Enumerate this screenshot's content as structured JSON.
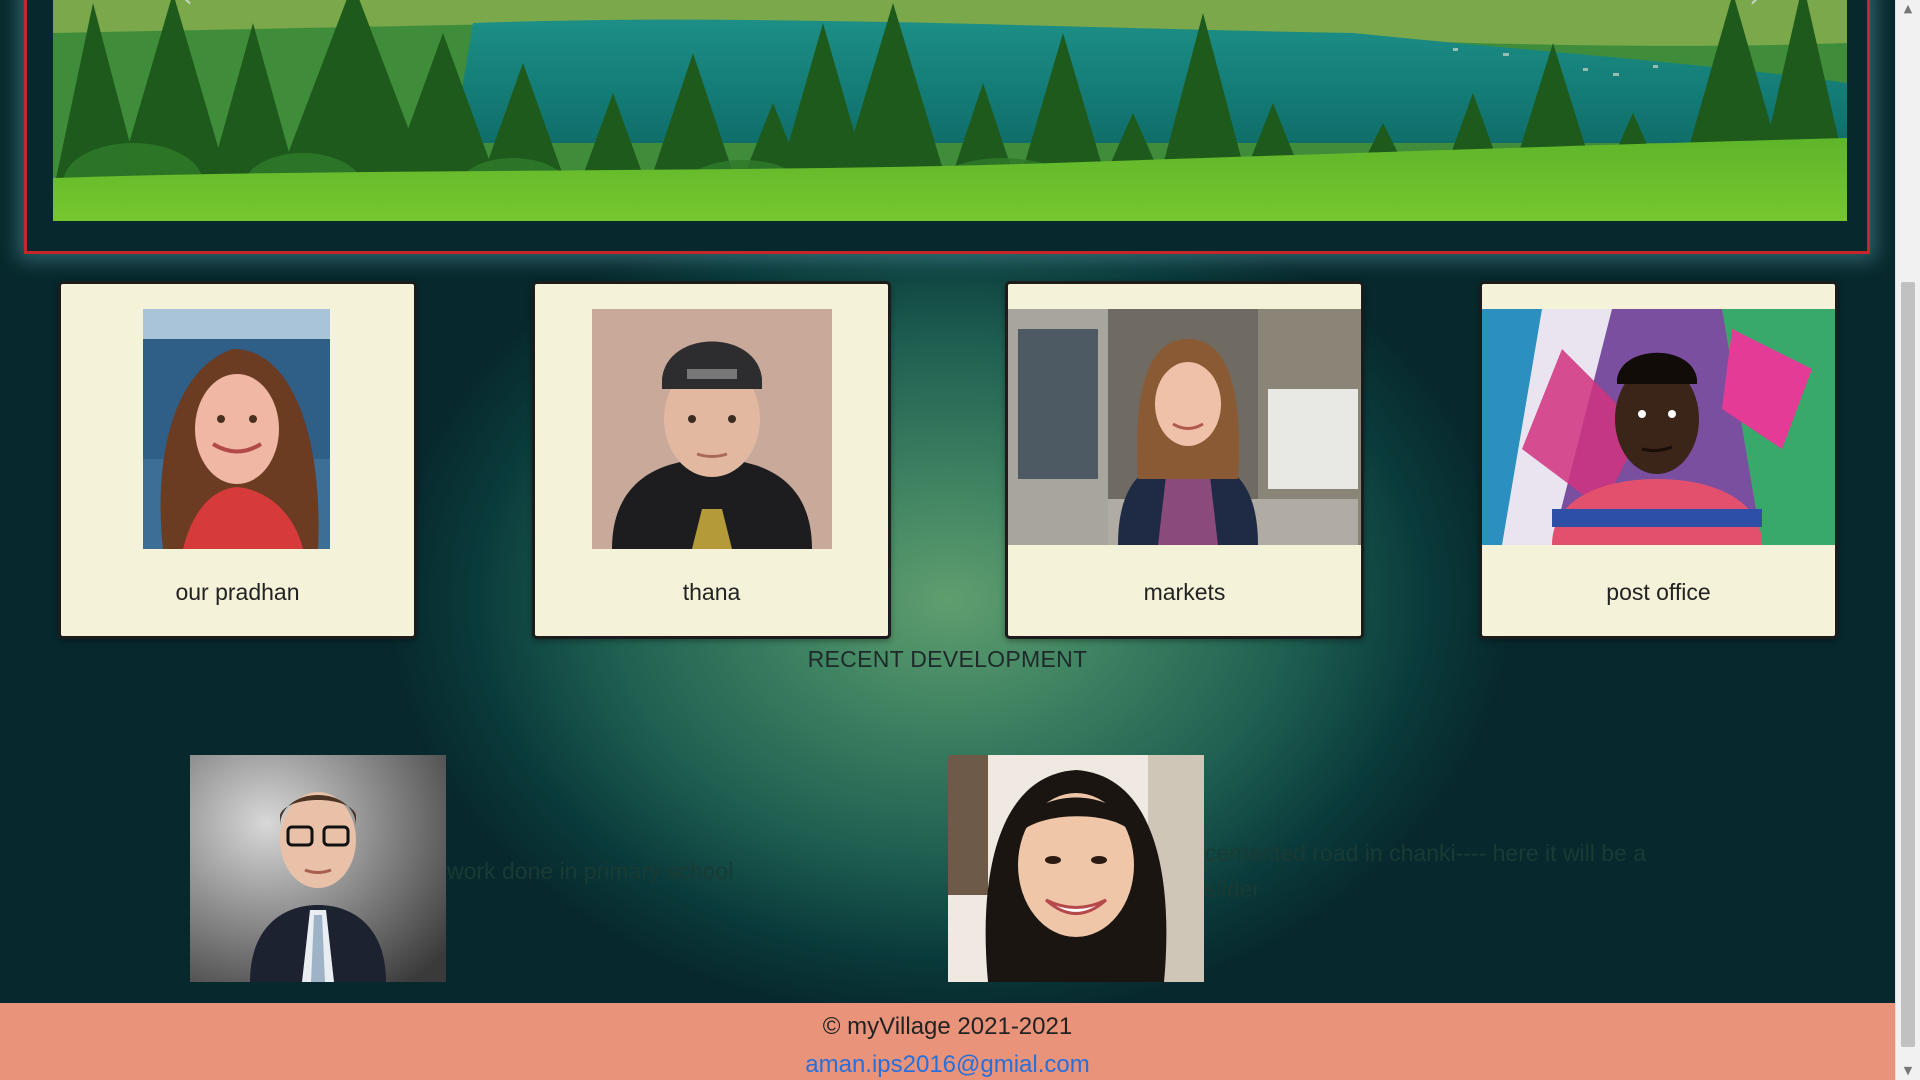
{
  "hero": {
    "prev_icon": "chevron-left-icon",
    "next_icon": "chevron-right-icon",
    "prev_glyph": "‹",
    "next_glyph": "›"
  },
  "cards": [
    {
      "label": "our pradhan",
      "image": "woman-selfie-photo"
    },
    {
      "label": "thana",
      "image": "man-cap-hoodie-photo"
    },
    {
      "label": "markets",
      "image": "woman-street-scarf-photo"
    },
    {
      "label": "post office",
      "image": "man-graffiti-wall-photo"
    }
  ],
  "recent_development": {
    "title": "RECENT DEVELOPMENT",
    "items": [
      {
        "text": "work done in primary school",
        "image": "man-glasses-suit-photo"
      },
      {
        "text": "cemented road in chanki----  here it will be a slider",
        "image": "smiling-woman-photo"
      }
    ]
  },
  "footer": {
    "copyright": "© myVillage 2021-2021",
    "email": "aman.ips2016@gmial.com"
  },
  "colors": {
    "footer_bg": "#e8937a",
    "card_bg": "#f4f3d9",
    "hero_border": "#c4262b",
    "link": "#2a6fd8"
  }
}
